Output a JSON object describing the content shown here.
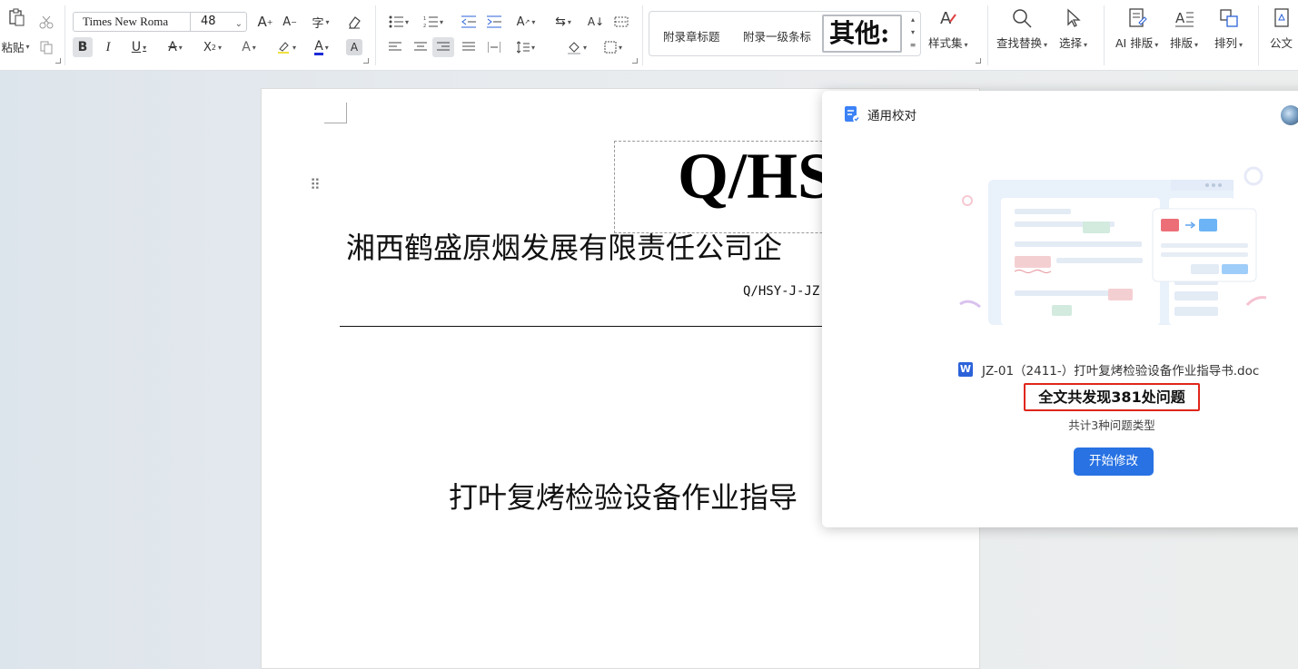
{
  "ribbon": {
    "clipboard": {
      "paste_label": "粘贴"
    },
    "font": {
      "name": "Times New Roma",
      "size": "48"
    },
    "styles": {
      "item1": "附录章标题",
      "item2": "附录一级条标",
      "item3": "其他:",
      "collection_label": "样式集"
    },
    "tools": {
      "find_replace": "查找替换",
      "select": "选择",
      "ai_layout": "AI 排版",
      "layout": "排版",
      "arrange": "排列",
      "official_doc": "公文"
    }
  },
  "document": {
    "standard_mark": "Q/HS",
    "company_line": "湘西鹤盛原烟发展有限责任公司企",
    "code_line": "Q/HSY-J-JZ",
    "doc_title": "打叶复烤检验设备作业指导"
  },
  "proofread_panel": {
    "title": "通用校对",
    "file_name": "JZ-01（2411-）打叶复烤检验设备作业指导书.doc",
    "summary": "全文共发现381处问题",
    "issue_count": 381,
    "issue_types": "共计3种问题类型",
    "start_button": "开始修改"
  },
  "colors": {
    "accent_blue": "#2872e3",
    "highlight_red": "#e0261a"
  }
}
